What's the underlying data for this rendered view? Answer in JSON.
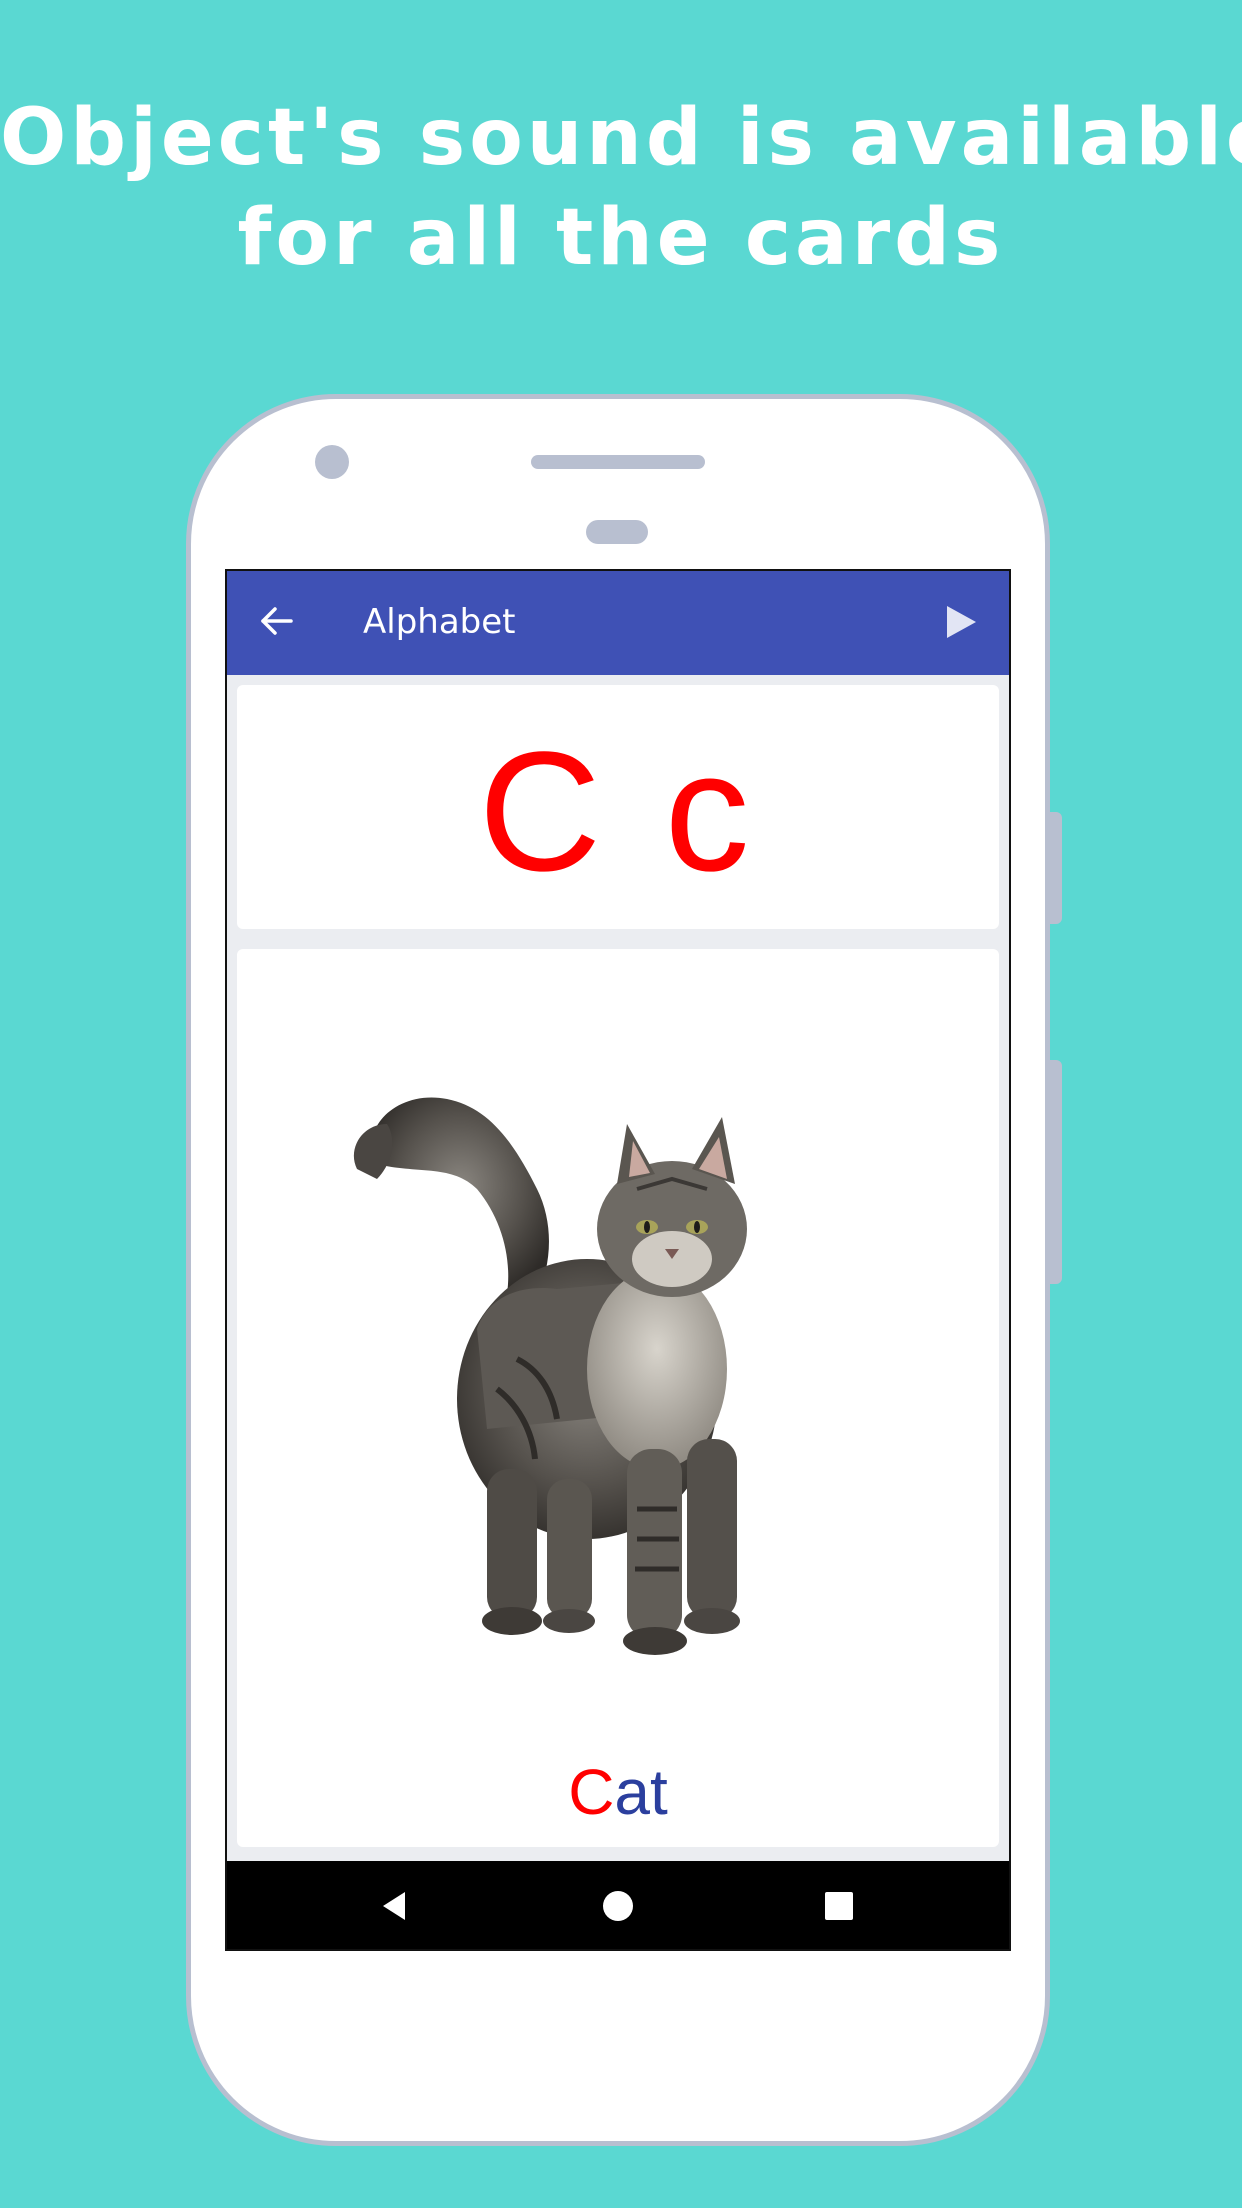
{
  "headline": {
    "line1": "Object's sound is available",
    "line2": "for all the cards"
  },
  "appbar": {
    "title": "Alphabet",
    "back_icon": "arrow-left-icon",
    "play_icon": "play-icon",
    "color": "#3f51b5"
  },
  "card": {
    "letters": "C c",
    "image_alt": "cat",
    "word_first": "C",
    "word_rest": "at"
  },
  "navbar": {
    "back_icon": "nav-back-triangle-icon",
    "home_icon": "nav-home-circle-icon",
    "recents_icon": "nav-recents-square-icon"
  },
  "colors": {
    "background": "#5ad8d2",
    "letter_red": "#ff0000",
    "word_blue": "#2b3f9e"
  }
}
